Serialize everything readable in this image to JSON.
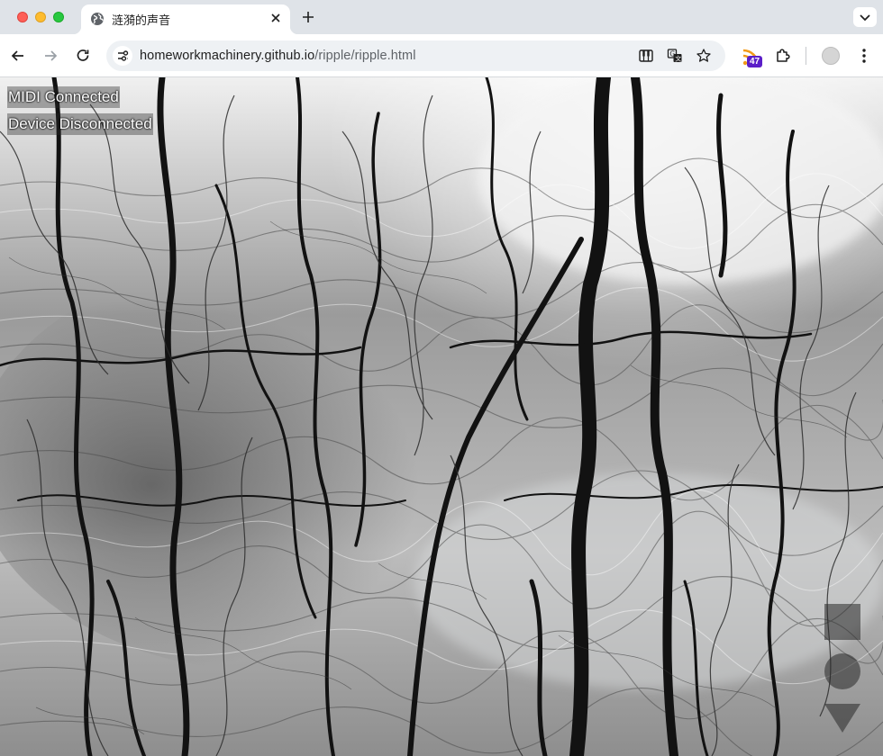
{
  "browser": {
    "tab": {
      "title": "涟漪的声音",
      "favicon": "globe-icon"
    },
    "address": {
      "host": "homeworkmachinery.github.io",
      "path": "/ripple/ripple.html"
    },
    "extensions": {
      "rss_badge": "47"
    },
    "colors": {
      "tabstrip": "#dfe3e8",
      "omnibox": "#eef1f4",
      "badge": "#5b1ec8"
    }
  },
  "page": {
    "status": {
      "midi": "MIDI Connected",
      "device": "Device Disconnected"
    },
    "controls": [
      "square-control",
      "circle-control",
      "triangle-control"
    ],
    "background": "black-and-white photo of tree roots reflected in rippling water"
  }
}
